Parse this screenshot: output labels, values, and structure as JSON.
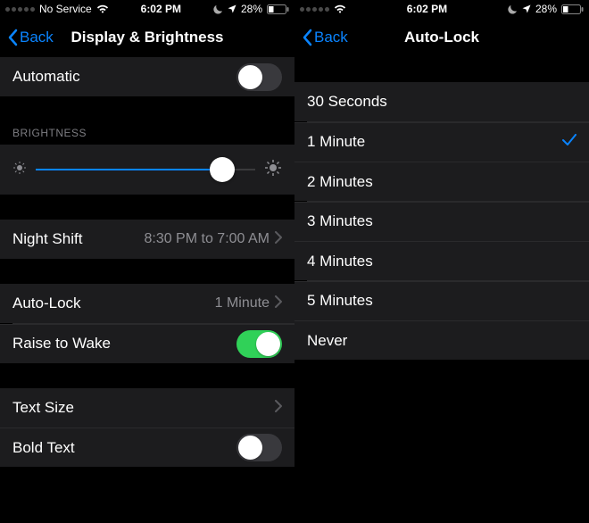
{
  "status": {
    "carrier": "No Service",
    "time": "6:02 PM",
    "battery_percent": "28%"
  },
  "left_screen": {
    "back_label": "Back",
    "title": "Display & Brightness",
    "automatic": {
      "label": "Automatic",
      "on": false
    },
    "brightness_header": "BRIGHTNESS",
    "brightness_value": 85,
    "night_shift": {
      "label": "Night Shift",
      "value": "8:30 PM to 7:00 AM"
    },
    "auto_lock": {
      "label": "Auto-Lock",
      "value": "1 Minute"
    },
    "raise_to_wake": {
      "label": "Raise to Wake",
      "on": true
    },
    "text_size": {
      "label": "Text Size"
    },
    "bold_text": {
      "label": "Bold Text",
      "on": false
    }
  },
  "right_screen": {
    "back_label": "Back",
    "title": "Auto-Lock",
    "options": [
      {
        "label": "30 Seconds",
        "selected": false
      },
      {
        "label": "1 Minute",
        "selected": true
      },
      {
        "label": "2 Minutes",
        "selected": false
      },
      {
        "label": "3 Minutes",
        "selected": false
      },
      {
        "label": "4 Minutes",
        "selected": false
      },
      {
        "label": "5 Minutes",
        "selected": false
      },
      {
        "label": "Never",
        "selected": false
      }
    ]
  }
}
